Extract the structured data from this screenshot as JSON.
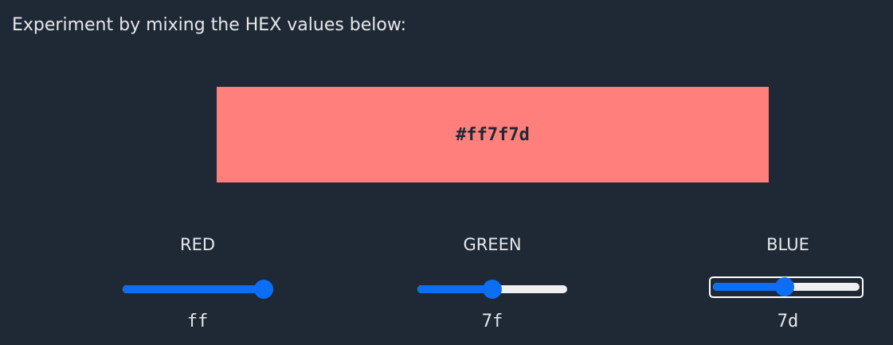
{
  "intro_text": "Experiment by mixing the HEX values below:",
  "swatch": {
    "hex_label": "#ff7f7d",
    "color": "#ff7f7d"
  },
  "channels": [
    {
      "label": "RED",
      "value_text": "ff",
      "value": 255,
      "max": 255,
      "focused": false
    },
    {
      "label": "GREEN",
      "value_text": "7f",
      "value": 127,
      "max": 255,
      "focused": false
    },
    {
      "label": "BLUE",
      "value_text": "7d",
      "value": 125,
      "max": 255,
      "focused": true
    }
  ],
  "colors": {
    "background": "#1f2935",
    "accent": "#0b6ef5",
    "track": "#efefef",
    "text": "#e6e8ea"
  }
}
